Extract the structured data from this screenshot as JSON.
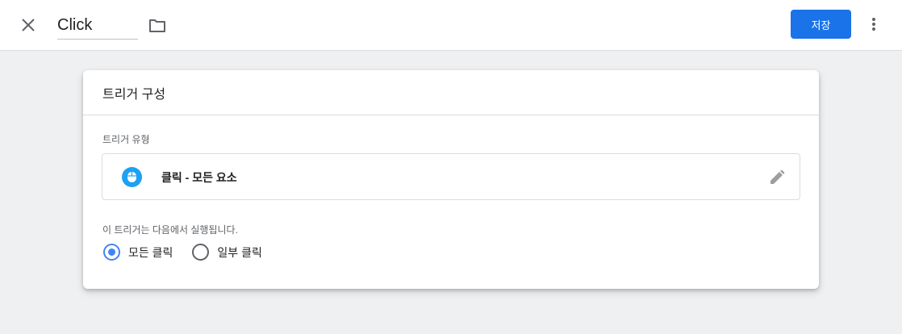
{
  "topbar": {
    "tag_name": "Click",
    "save_label": "저장",
    "icons": {
      "close": "close-icon",
      "folder": "folder-icon",
      "more": "more-vert-icon"
    }
  },
  "card": {
    "title": "트리거 구성",
    "trigger_type_label": "트리거 유형",
    "trigger_type_value": "클릭 - 모든 요소",
    "trigger_type_icon": "mouse-icon",
    "edit_icon": "pencil-icon",
    "fires_on_label": "이 트리거는 다음에서 실행됩니다.",
    "options": [
      {
        "label": "모든 클릭",
        "selected": true
      },
      {
        "label": "일부 클릭",
        "selected": false
      }
    ]
  },
  "colors": {
    "accent": "#1a73e8",
    "radio_selected": "#4285f4",
    "icon_badge": "#1da1f2",
    "background": "#eff0f2"
  }
}
